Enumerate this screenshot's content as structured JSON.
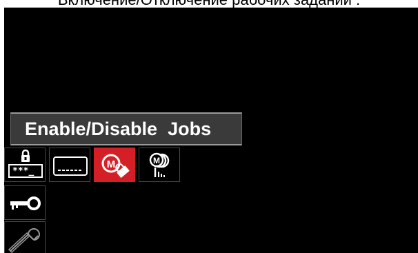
{
  "caption": "Включение/Отключение рабочих заданий :",
  "screen": {
    "title": "Enable/Disable  Jobs"
  },
  "icons": {
    "row_top": [
      "lock-password-icon",
      "blank-entry-icon",
      "memory-lock-icon",
      "memory-list-icon"
    ],
    "column_left": [
      "key-icon",
      "wrench-icon"
    ]
  },
  "colors": {
    "background": "#000000",
    "accent": "#d41f26",
    "title_bar": "#3a3a3a"
  }
}
